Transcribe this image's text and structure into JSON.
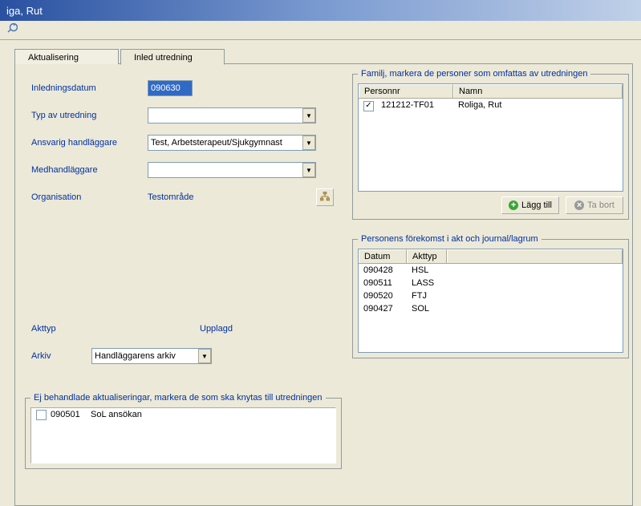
{
  "title": "iga, Rut",
  "tabs": [
    {
      "label": "Aktualisering"
    },
    {
      "label": "Inled utredning"
    }
  ],
  "form": {
    "inlednings_label": "Inledningsdatum",
    "inlednings_value": "090630",
    "typ_label": "Typ av utredning",
    "typ_value": "",
    "ansvarig_label": "Ansvarig handläggare",
    "ansvarig_value": "Test, Arbetsterapeut/Sjukgymnast",
    "med_label": "Medhandläggare",
    "med_value": "",
    "org_label": "Organisation",
    "org_value": "Testområde"
  },
  "familj": {
    "legend": "Familj, markera de personer som omfattas av utredningen",
    "headers": {
      "personnr": "Personnr",
      "namn": "Namn"
    },
    "rows": [
      {
        "checked": true,
        "personnr": "121212-TF01",
        "namn": "Roliga, Rut"
      }
    ],
    "add_label": "Lägg till",
    "remove_label": "Ta bort"
  },
  "forekomst": {
    "legend": "Personens förekomst i akt och journal/lagrum",
    "headers": {
      "datum": "Datum",
      "akttyp": "Akttyp"
    },
    "rows": [
      {
        "datum": "090428",
        "akttyp": "HSL"
      },
      {
        "datum": "090511",
        "akttyp": "LASS"
      },
      {
        "datum": "090520",
        "akttyp": "FTJ"
      },
      {
        "datum": "090427",
        "akttyp": "SOL"
      }
    ]
  },
  "akt": {
    "akttyp_label": "Akttyp",
    "upplagd_label": "Upplagd",
    "arkiv_label": "Arkiv",
    "arkiv_value": "Handläggarens arkiv"
  },
  "ejbehandlade": {
    "legend": "Ej behandlade aktualiseringar, markera de som ska knytas till utredningen",
    "rows": [
      {
        "checked": false,
        "datum": "090501",
        "text": "SoL ansökan"
      }
    ]
  }
}
